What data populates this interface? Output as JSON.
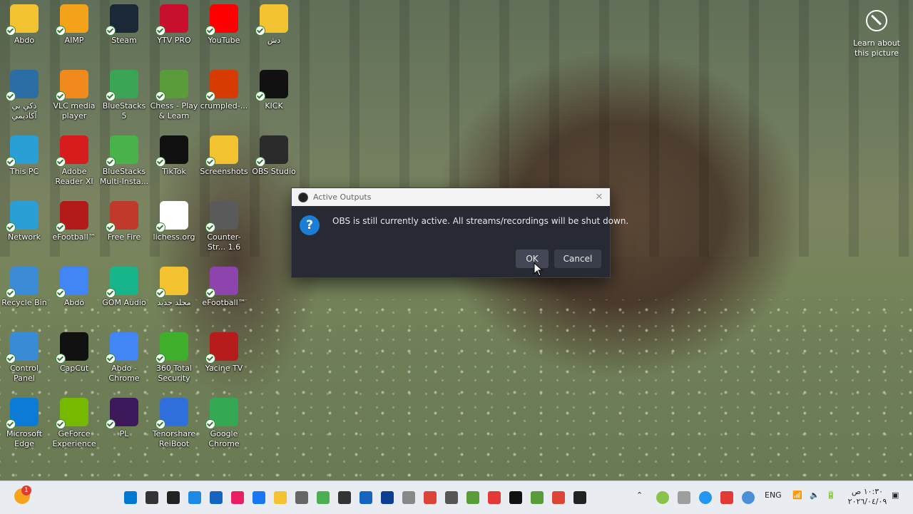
{
  "desktop": {
    "icons": [
      {
        "label": "Abdo",
        "color": "#f2c230"
      },
      {
        "label": "AIMP",
        "color": "#f4a21a"
      },
      {
        "label": "Steam",
        "color": "#1b2838"
      },
      {
        "label": "YTV PRO",
        "color": "#c8102e"
      },
      {
        "label": "YouTube",
        "color": "#ff0000"
      },
      {
        "label": "دش",
        "color": "#f2c230"
      },
      {
        "label": "ذكي بي آكاديمي",
        "color": "#2b6ea6"
      },
      {
        "label": "VLC media player",
        "color": "#f08a1c"
      },
      {
        "label": "BlueStacks 5",
        "color": "#3aa655"
      },
      {
        "label": "Chess - Play & Learn",
        "color": "#5a9c3a"
      },
      {
        "label": "crumpled-...",
        "color": "#d83b01"
      },
      {
        "label": "KICK",
        "color": "#111111"
      },
      {
        "label": "This PC",
        "color": "#2a9fd6"
      },
      {
        "label": "Adobe Reader XI",
        "color": "#d61c1c"
      },
      {
        "label": "BlueStacks Multi-Insta...",
        "color": "#49b34a"
      },
      {
        "label": "TikTok",
        "color": "#111111"
      },
      {
        "label": "Screenshots",
        "color": "#f2c230"
      },
      {
        "label": "OBS Studio",
        "color": "#2b2b2b"
      },
      {
        "label": "Network",
        "color": "#2a9fd6"
      },
      {
        "label": "eFootball™",
        "color": "#b31b1b"
      },
      {
        "label": "Free Fire",
        "color": "#c0392b"
      },
      {
        "label": "lichess.org",
        "color": "#ffffff"
      },
      {
        "label": "Counter-Str... 1.6",
        "color": "#5a5a5a"
      },
      {
        "label": "Recycle Bin",
        "color": "#3b8bd6"
      },
      {
        "label": "Abdo",
        "color": "#4285f4"
      },
      {
        "label": "GOM Audio",
        "color": "#19b58a"
      },
      {
        "label": "مجلد جديد",
        "color": "#f2c230"
      },
      {
        "label": "eFootball™",
        "color": "#8e44ad"
      },
      {
        "label": "Control Panel",
        "color": "#3a8bd6"
      },
      {
        "label": "CapCut",
        "color": "#111111"
      },
      {
        "label": "Abdo - Chrome",
        "color": "#4285f4"
      },
      {
        "label": "360 Total Security",
        "color": "#3fae2a"
      },
      {
        "label": "Yacine TV",
        "color": "#b71c1c"
      },
      {
        "label": "Microsoft Edge",
        "color": "#0c7bd6"
      },
      {
        "label": "GeForce Experience",
        "color": "#76b900"
      },
      {
        "label": "PL",
        "color": "#3d195b"
      },
      {
        "label": "Tenorshare ReiBoot",
        "color": "#2f6fdc"
      },
      {
        "label": "Google Chrome",
        "color": "#34a853"
      }
    ],
    "learn": "Learn about this picture"
  },
  "dialog": {
    "title": "Active Outputs",
    "message": "OBS is still currently active. All streams/recordings will be shut down.",
    "ok": "OK",
    "cancel": "Cancel"
  },
  "taskbar": {
    "notification_count": "1",
    "apps": [
      "#0078d4",
      "#333333",
      "#222222",
      "#1e88e5",
      "#1565c0",
      "#e91e63",
      "#1877f2",
      "#f2c230",
      "#666666",
      "#4caf50",
      "#333333",
      "#1565c0",
      "#0b3d91",
      "#888888",
      "#db4437",
      "#555555",
      "#5a9c3a",
      "#e53935",
      "#111111",
      "#5a9c3a",
      "#db4437",
      "#222222"
    ],
    "language": "ENG",
    "time": "١٠:٣٠ ص",
    "date": "٢٠٢٦/٠٤/٠٩"
  }
}
